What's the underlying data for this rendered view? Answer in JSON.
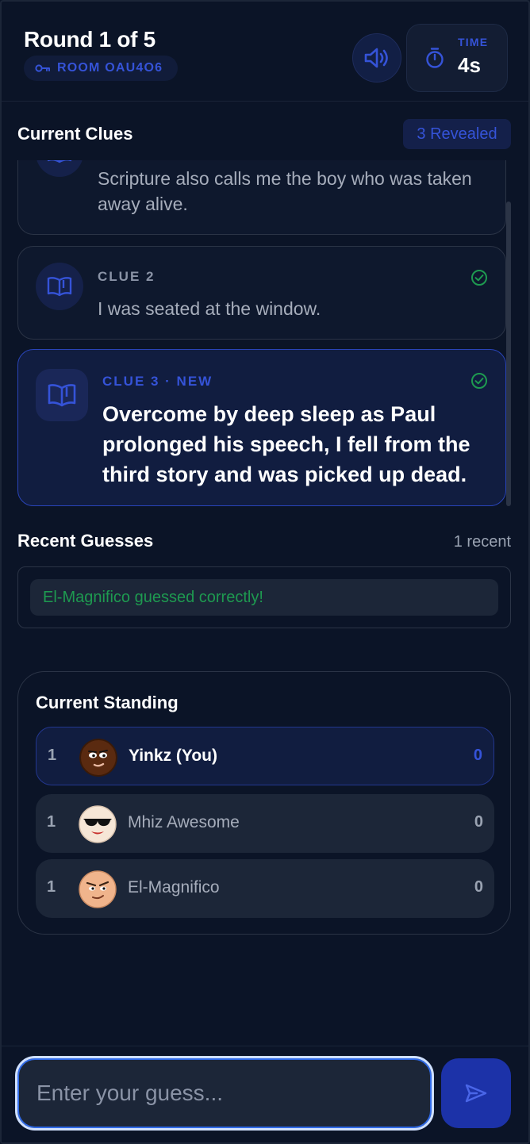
{
  "header": {
    "round_title": "Round 1 of 5",
    "room_label": "ROOM OAU4O6",
    "timer_label": "TIME",
    "timer_value": "4s",
    "icons": {
      "room": "key-icon",
      "sound": "speaker-icon",
      "timer": "stopwatch-icon"
    }
  },
  "clues": {
    "title": "Current Clues",
    "revealed_badge": "3 Revealed",
    "items": [
      {
        "label": "",
        "text": "Scripture also calls me the boy who was taken away alive.",
        "checked": false
      },
      {
        "label": "CLUE 2",
        "text": "I was seated at the window.",
        "checked": true
      },
      {
        "label": "CLUE 3 · NEW",
        "text": "Overcome by deep sleep as Paul prolonged his speech, I fell from the third story and was picked up dead.",
        "checked": true
      }
    ]
  },
  "guesses": {
    "title": "Recent Guesses",
    "count_label": "1 recent",
    "items": [
      {
        "text": "El-Magnifico guessed correctly!"
      }
    ]
  },
  "standing": {
    "title": "Current Standing",
    "players": [
      {
        "rank": "1",
        "name": "Yinkz (You)",
        "score": "0",
        "is_me": true
      },
      {
        "rank": "1",
        "name": "Mhiz Awesome",
        "score": "0",
        "is_me": false
      },
      {
        "rank": "1",
        "name": "El-Magnifico",
        "score": "0",
        "is_me": false
      }
    ]
  },
  "input": {
    "placeholder": "Enter your guess...",
    "value": ""
  },
  "colors": {
    "background": "#0b1427",
    "accent": "#3553d8",
    "success": "#1e9a50",
    "card_border": "#2b3446"
  }
}
